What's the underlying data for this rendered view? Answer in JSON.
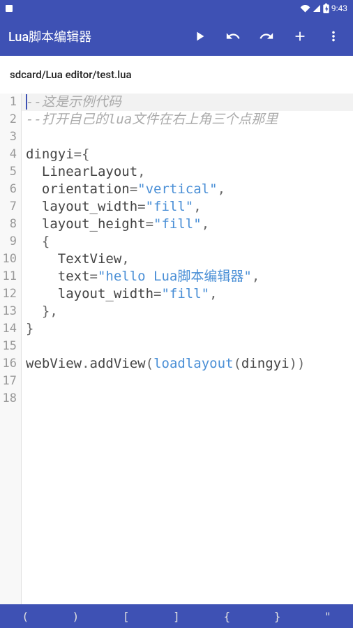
{
  "status": {
    "time": "9:43"
  },
  "appbar": {
    "title": "Lua脚本编辑器"
  },
  "file_path": "sdcard/Lua editor/test.lua",
  "code": {
    "cursor_line": 1,
    "lines": [
      {
        "n": 1,
        "tokens": [
          {
            "t": "--这是示例代码",
            "c": "comment"
          }
        ]
      },
      {
        "n": 2,
        "tokens": [
          {
            "t": "--打开自己的lua文件在右上角三个点那里",
            "c": "comment"
          }
        ]
      },
      {
        "n": 3,
        "tokens": []
      },
      {
        "n": 4,
        "tokens": [
          {
            "t": "dingyi",
            "c": "id"
          },
          {
            "t": "=",
            "c": "op"
          },
          {
            "t": "{",
            "c": "op"
          }
        ]
      },
      {
        "n": 5,
        "tokens": [
          {
            "t": "  LinearLayout",
            "c": "id"
          },
          {
            "t": ",",
            "c": "op"
          }
        ]
      },
      {
        "n": 6,
        "tokens": [
          {
            "t": "  orientation",
            "c": "id"
          },
          {
            "t": "=",
            "c": "op"
          },
          {
            "t": "\"vertical\"",
            "c": "str"
          },
          {
            "t": ",",
            "c": "op"
          }
        ]
      },
      {
        "n": 7,
        "tokens": [
          {
            "t": "  layout_width",
            "c": "id"
          },
          {
            "t": "=",
            "c": "op"
          },
          {
            "t": "\"fill\"",
            "c": "str"
          },
          {
            "t": ",",
            "c": "op"
          }
        ]
      },
      {
        "n": 8,
        "tokens": [
          {
            "t": "  layout_height",
            "c": "id"
          },
          {
            "t": "=",
            "c": "op"
          },
          {
            "t": "\"fill\"",
            "c": "str"
          },
          {
            "t": ",",
            "c": "op"
          }
        ]
      },
      {
        "n": 9,
        "tokens": [
          {
            "t": "  ",
            "c": "id"
          },
          {
            "t": "{",
            "c": "op"
          }
        ]
      },
      {
        "n": 10,
        "tokens": [
          {
            "t": "    TextView",
            "c": "id"
          },
          {
            "t": ",",
            "c": "op"
          }
        ]
      },
      {
        "n": 11,
        "tokens": [
          {
            "t": "    text",
            "c": "id"
          },
          {
            "t": "=",
            "c": "op"
          },
          {
            "t": "\"hello Lua脚本编辑器\"",
            "c": "str"
          },
          {
            "t": ",",
            "c": "op"
          }
        ]
      },
      {
        "n": 12,
        "tokens": [
          {
            "t": "    layout_width",
            "c": "id"
          },
          {
            "t": "=",
            "c": "op"
          },
          {
            "t": "\"fill\"",
            "c": "str"
          },
          {
            "t": ",",
            "c": "op"
          }
        ]
      },
      {
        "n": 13,
        "tokens": [
          {
            "t": "  ",
            "c": "id"
          },
          {
            "t": "}",
            "c": "op"
          },
          {
            "t": ",",
            "c": "op"
          }
        ]
      },
      {
        "n": 14,
        "tokens": [
          {
            "t": "}",
            "c": "op"
          }
        ]
      },
      {
        "n": 15,
        "tokens": []
      },
      {
        "n": 16,
        "tokens": [
          {
            "t": "webView",
            "c": "id"
          },
          {
            "t": ".",
            "c": "op"
          },
          {
            "t": "addView",
            "c": "id"
          },
          {
            "t": "(",
            "c": "op"
          },
          {
            "t": "loadlayout",
            "c": "func"
          },
          {
            "t": "(",
            "c": "op"
          },
          {
            "t": "dingyi",
            "c": "id"
          },
          {
            "t": "))",
            "c": "op"
          }
        ]
      },
      {
        "n": 17,
        "tokens": []
      },
      {
        "n": 18,
        "tokens": []
      }
    ]
  },
  "symbols": [
    "(",
    ")",
    "[",
    "]",
    "{",
    "}",
    "\""
  ]
}
